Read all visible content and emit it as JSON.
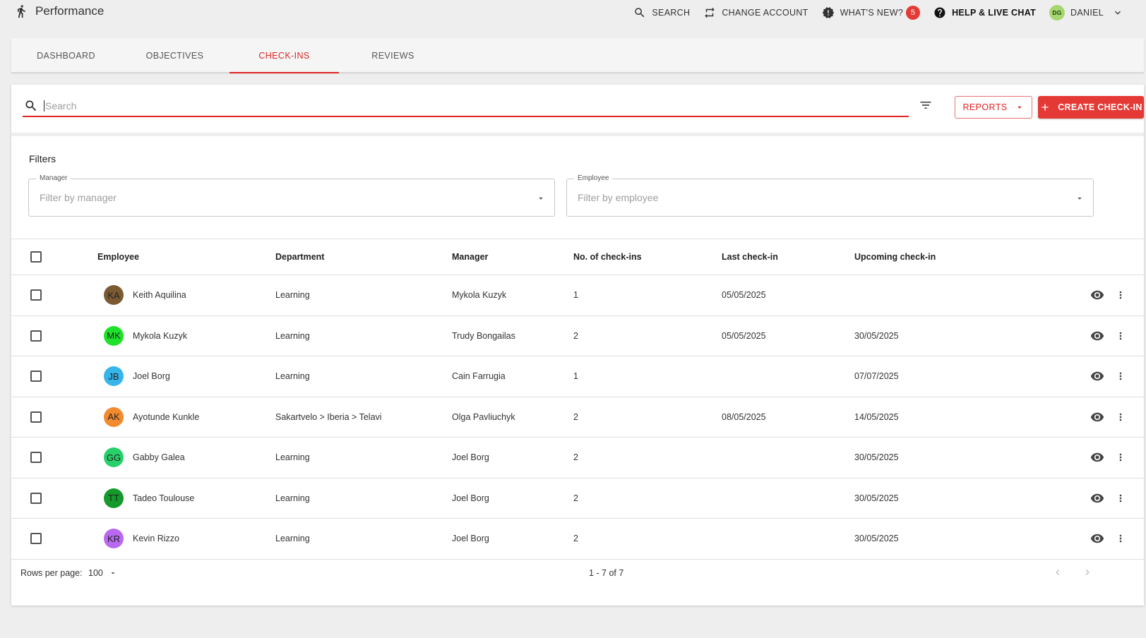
{
  "app": {
    "title": "Performance",
    "icon": "running-person-icon"
  },
  "top_actions": {
    "search": "SEARCH",
    "change_account": "CHANGE ACCOUNT",
    "whats_new": "WHAT'S NEW?",
    "whats_new_count": "5",
    "help": "HELP & LIVE CHAT",
    "user_initials": "DG",
    "user_name": "DANIEL"
  },
  "tabs": [
    {
      "label": "DASHBOARD",
      "active": false
    },
    {
      "label": "OBJECTIVES",
      "active": false
    },
    {
      "label": "CHECK-INS",
      "active": true
    },
    {
      "label": "REVIEWS",
      "active": false
    }
  ],
  "search": {
    "placeholder": "Search",
    "value": ""
  },
  "toolbar": {
    "reports": "REPORTS",
    "create": "CREATE CHECK-IN"
  },
  "filters": {
    "title": "Filters",
    "manager": {
      "label": "Manager",
      "placeholder": "Filter by manager"
    },
    "employee": {
      "label": "Employee",
      "placeholder": "Filter by employee"
    }
  },
  "table": {
    "columns": [
      "Employee",
      "Department",
      "Manager",
      "No. of check-ins",
      "Last check-in",
      "Upcoming check-in"
    ],
    "rows": [
      {
        "initials": "KA",
        "avatar_color": "#7b5a32",
        "employee": "Keith Aquilina",
        "department": "Learning",
        "manager": "Mykola Kuzyk",
        "checkins": "1",
        "last": "05/05/2025",
        "upcoming": ""
      },
      {
        "initials": "MK",
        "avatar_color": "#1ee22a",
        "employee": "Mykola Kuzyk",
        "department": "Learning",
        "manager": "Trudy Bongailas",
        "checkins": "2",
        "last": "05/05/2025",
        "upcoming": "30/05/2025"
      },
      {
        "initials": "JB",
        "avatar_color": "#35b5ea",
        "employee": "Joel Borg",
        "department": "Learning",
        "manager": "Cain Farrugia",
        "checkins": "1",
        "last": "",
        "upcoming": "07/07/2025"
      },
      {
        "initials": "AK",
        "avatar_color": "#f28a2e",
        "employee": "Ayotunde Kunkle",
        "department": "Sakartvelo > Iberia > Telavi",
        "manager": "Olga Pavliuchyk",
        "checkins": "2",
        "last": "08/05/2025",
        "upcoming": "14/05/2025"
      },
      {
        "initials": "GG",
        "avatar_color": "#27d06a",
        "employee": "Gabby Galea",
        "department": "Learning",
        "manager": "Joel Borg",
        "checkins": "2",
        "last": "",
        "upcoming": "30/05/2025"
      },
      {
        "initials": "TT",
        "avatar_color": "#139a2b",
        "employee": "Tadeo Toulouse",
        "department": "Learning",
        "manager": "Joel Borg",
        "checkins": "2",
        "last": "",
        "upcoming": "30/05/2025"
      },
      {
        "initials": "KR",
        "avatar_color": "#b968f0",
        "employee": "Kevin Rizzo",
        "department": "Learning",
        "manager": "Joel Borg",
        "checkins": "2",
        "last": "",
        "upcoming": "30/05/2025"
      }
    ]
  },
  "pagination": {
    "rows_per_page_label": "Rows per page:",
    "rows_per_page": "100",
    "range": "1 - 7 of 7"
  },
  "colors": {
    "accent": "#e53935",
    "background": "#eeeeee"
  }
}
